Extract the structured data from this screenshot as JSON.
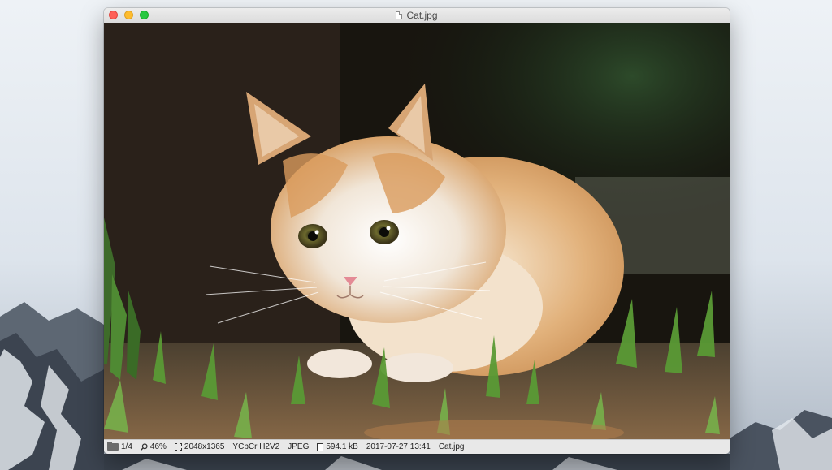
{
  "window": {
    "title": "Cat.jpg"
  },
  "statusbar": {
    "position": "1/4",
    "zoom": "46%",
    "dimensions": "2048x1365",
    "colorspace": "YCbCr H2V2",
    "format": "JPEG",
    "filesize": "594.1 kB",
    "datetime": "2017-07-27 13:41",
    "filename": "Cat.jpg"
  },
  "icons": {
    "close": "close-button-icon",
    "minimize": "minimize-button-icon",
    "zoom": "zoom-button-icon",
    "title_doc": "document-icon",
    "folder": "folder-icon",
    "magnifier": "magnifier-icon",
    "dimensions": "dimensions-icon",
    "file": "file-icon"
  },
  "colors": {
    "close": "#fe5f57",
    "minimize": "#febc2e",
    "zoom": "#28c840"
  }
}
